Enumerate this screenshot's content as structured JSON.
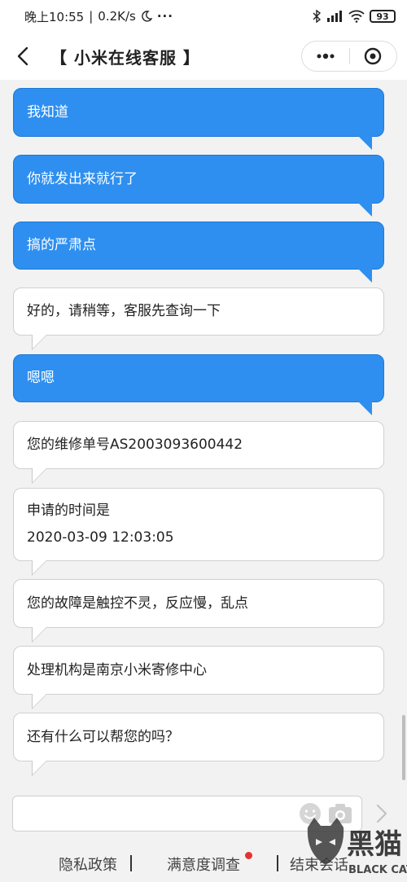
{
  "status_bar": {
    "time": "晚上10:55",
    "speed": "0.2K/s",
    "battery": "93"
  },
  "header": {
    "title": "【 小米在线客服 】"
  },
  "messages": [
    {
      "side": "out",
      "lines": [
        "我知道"
      ]
    },
    {
      "side": "out",
      "lines": [
        "你就发出来就行了"
      ]
    },
    {
      "side": "out",
      "lines": [
        "搞的严肃点"
      ]
    },
    {
      "side": "in",
      "lines": [
        "好的，请稍等，客服先查询一下"
      ]
    },
    {
      "side": "out",
      "lines": [
        "嗯嗯"
      ]
    },
    {
      "side": "in",
      "lines": [
        "您的维修单号AS2003093600442"
      ]
    },
    {
      "side": "in",
      "lines": [
        "申请的时间是",
        "2020-03-09 12:03:05"
      ]
    },
    {
      "side": "in",
      "lines": [
        "您的故障是触控不灵，反应慢，乱点"
      ]
    },
    {
      "side": "in",
      "lines": [
        "处理机构是南京小米寄修中心"
      ]
    },
    {
      "side": "in",
      "lines": [
        "还有什么可以帮您的吗？"
      ]
    }
  ],
  "input": {
    "value": "",
    "placeholder": ""
  },
  "footer": {
    "privacy": "隐私政策",
    "survey": "满意度调查",
    "end": "结束会话"
  },
  "watermark": {
    "brand": "黑猫",
    "sub": "BLACK CAT"
  },
  "colors": {
    "outgoing_bubble": "#2e8ff0",
    "incoming_bubble": "#ffffff",
    "badge": "#e5322d"
  }
}
